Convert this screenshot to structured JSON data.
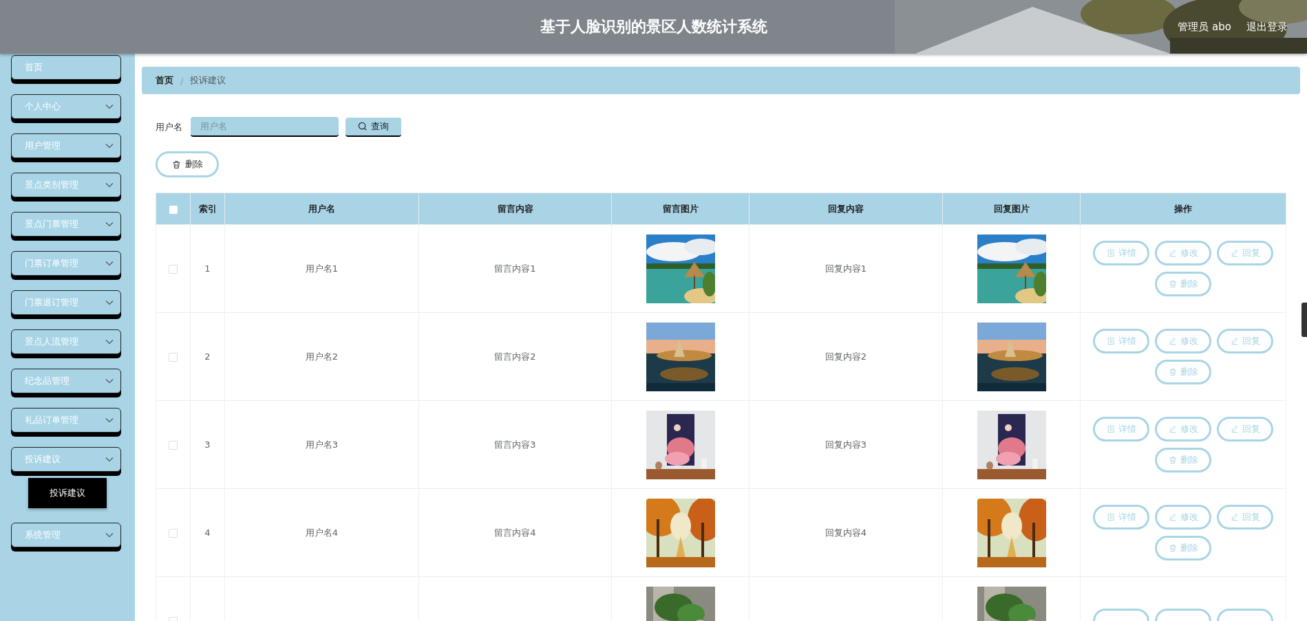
{
  "header": {
    "title": "基于人脸识别的景区人数统计系统",
    "user": "管理员 abo",
    "logout": "退出登录"
  },
  "sidebar": {
    "items": [
      {
        "label": "首页",
        "expandable": false
      },
      {
        "label": "个人中心",
        "expandable": true
      },
      {
        "label": "用户管理",
        "expandable": true
      },
      {
        "label": "景点类别管理",
        "expandable": true
      },
      {
        "label": "景点门票管理",
        "expandable": true
      },
      {
        "label": "门票订单管理",
        "expandable": true
      },
      {
        "label": "门票退订管理",
        "expandable": true
      },
      {
        "label": "景点人流管理",
        "expandable": true
      },
      {
        "label": "纪念品管理",
        "expandable": true
      },
      {
        "label": "礼品订单管理",
        "expandable": true
      },
      {
        "label": "投诉建议",
        "expandable": true,
        "children": [
          {
            "label": "投诉建议"
          }
        ]
      },
      {
        "label": "系统管理",
        "expandable": true
      }
    ]
  },
  "breadcrumb_separator": "/",
  "breadcrumb": [
    {
      "label": "首页",
      "current": false
    },
    {
      "label": "投诉建议",
      "current": true
    }
  ],
  "search": {
    "label": "用户名",
    "placeholder": "用户名",
    "button": "查询"
  },
  "delete_button": "删除",
  "table": {
    "select_all_checked": false,
    "columns": [
      "索引",
      "用户名",
      "留言内容",
      "留言图片",
      "回复内容",
      "回复图片",
      "操作"
    ],
    "rows": [
      {
        "checked": false,
        "index": "1",
        "username": "用户名1",
        "message": "留言内容1",
        "message_image": {
          "kind": "picture"
        },
        "reply": "回复内容1",
        "reply_image": {
          "kind": "picture"
        },
        "actions": [
          {
            "kind": "detail",
            "label": "详情"
          },
          {
            "kind": "edit",
            "label": "修改"
          },
          {
            "kind": "edit",
            "label": "回复"
          },
          {
            "kind": "delete",
            "label": "删除"
          }
        ]
      },
      {
        "checked": false,
        "index": "2",
        "username": "用户名2",
        "message": "留言内容2",
        "message_image": {
          "kind": "picture"
        },
        "reply": "回复内容2",
        "reply_image": {
          "kind": "picture"
        },
        "actions": [
          {
            "kind": "detail",
            "label": "详情"
          },
          {
            "kind": "edit",
            "label": "修改"
          },
          {
            "kind": "edit",
            "label": "回复"
          },
          {
            "kind": "delete",
            "label": "删除"
          }
        ]
      },
      {
        "checked": false,
        "index": "3",
        "username": "用户名3",
        "message": "留言内容3",
        "message_image": {
          "kind": "picture"
        },
        "reply": "回复内容3",
        "reply_image": {
          "kind": "picture"
        },
        "actions": [
          {
            "kind": "detail",
            "label": "详情"
          },
          {
            "kind": "edit",
            "label": "修改"
          },
          {
            "kind": "edit",
            "label": "回复"
          },
          {
            "kind": "delete",
            "label": "删除"
          }
        ]
      },
      {
        "checked": false,
        "index": "4",
        "username": "用户名4",
        "message": "留言内容4",
        "message_image": {
          "kind": "picture"
        },
        "reply": "回复内容4",
        "reply_image": {
          "kind": "picture"
        },
        "actions": [
          {
            "kind": "detail",
            "label": "详情"
          },
          {
            "kind": "edit",
            "label": "修改"
          },
          {
            "kind": "edit",
            "label": "回复"
          },
          {
            "kind": "delete",
            "label": "删除"
          }
        ]
      },
      {
        "checked": false,
        "message_image": {
          "kind": "picture"
        },
        "reply_image": {
          "kind": "picture"
        },
        "actions": [
          {
            "kind": "detail"
          },
          {
            "kind": "edit"
          },
          {
            "kind": "edit"
          }
        ]
      }
    ]
  }
}
